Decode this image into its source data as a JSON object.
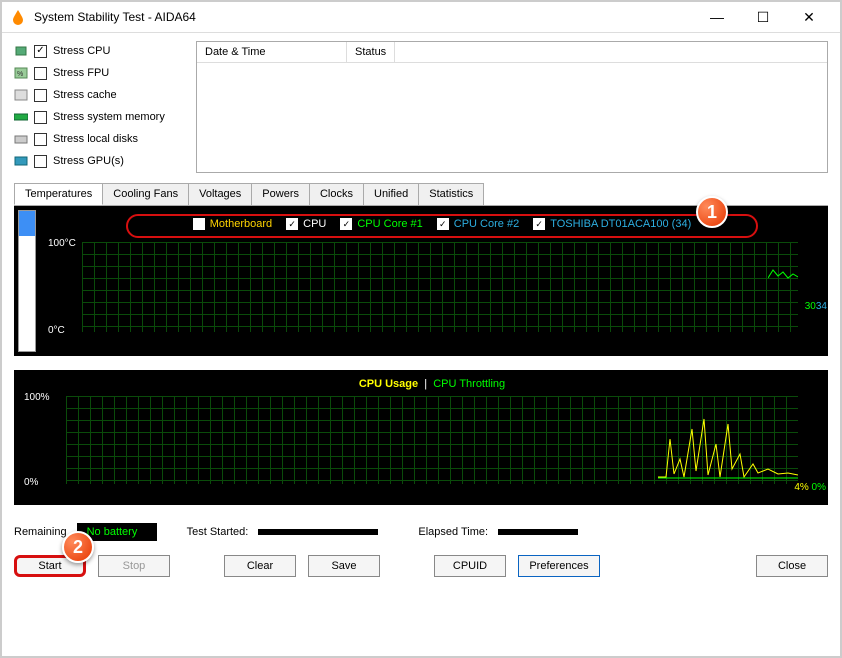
{
  "window": {
    "title": "System Stability Test - AIDA64"
  },
  "stress_options": [
    {
      "label": "Stress CPU",
      "checked": true
    },
    {
      "label": "Stress FPU",
      "checked": false
    },
    {
      "label": "Stress cache",
      "checked": false
    },
    {
      "label": "Stress system memory",
      "checked": false
    },
    {
      "label": "Stress local disks",
      "checked": false
    },
    {
      "label": "Stress GPU(s)",
      "checked": false
    }
  ],
  "status_table": {
    "col_datetime": "Date & Time",
    "col_status": "Status"
  },
  "tabs": [
    "Temperatures",
    "Cooling Fans",
    "Voltages",
    "Powers",
    "Clocks",
    "Unified",
    "Statistics"
  ],
  "active_tab": 0,
  "temp_chart": {
    "legend": [
      {
        "label": "Motherboard",
        "checked": false,
        "color": "#ffd400"
      },
      {
        "label": "CPU",
        "checked": true,
        "color": "#ffffff"
      },
      {
        "label": "CPU Core #1",
        "checked": true,
        "color": "#00ff00"
      },
      {
        "label": "CPU Core #2",
        "checked": true,
        "color": "#2daee0"
      },
      {
        "label": "TOSHIBA DT01ACA100 (34)",
        "checked": true,
        "color": "#2daee0"
      }
    ],
    "y_top": "100°C",
    "y_bottom": "0°C",
    "right_vals": {
      "a": "30",
      "b": "34"
    }
  },
  "usage_chart": {
    "title_a": "CPU Usage",
    "title_sep": "|",
    "title_b": "CPU Throttling",
    "y_top": "100%",
    "y_bottom": "0%",
    "right_vals": {
      "a": "4%",
      "b": "0%"
    }
  },
  "info": {
    "remaining_lbl": "Remaining",
    "battery_txt": "No battery",
    "test_started_lbl": "Test Started:",
    "test_started_val": "",
    "elapsed_lbl": "Elapsed Time:",
    "elapsed_val": ""
  },
  "buttons": {
    "start": "Start",
    "stop": "Stop",
    "clear": "Clear",
    "save": "Save",
    "cpuid": "CPUID",
    "prefs": "Preferences",
    "close": "Close"
  },
  "badges": {
    "one": "1",
    "two": "2"
  },
  "chart_data": [
    {
      "type": "line",
      "title": "Temperatures",
      "ylabel": "°C",
      "ylim": [
        0,
        100
      ],
      "series": [
        {
          "name": "CPU",
          "last_value": null
        },
        {
          "name": "CPU Core #1",
          "last_value": 30
        },
        {
          "name": "CPU Core #2",
          "last_value": 34
        },
        {
          "name": "TOSHIBA DT01ACA100 (34)",
          "last_value": 34
        }
      ]
    },
    {
      "type": "line",
      "title": "CPU Usage | CPU Throttling",
      "ylabel": "%",
      "ylim": [
        0,
        100
      ],
      "series": [
        {
          "name": "CPU Usage",
          "last_value": 4
        },
        {
          "name": "CPU Throttling",
          "last_value": 0
        }
      ]
    }
  ]
}
